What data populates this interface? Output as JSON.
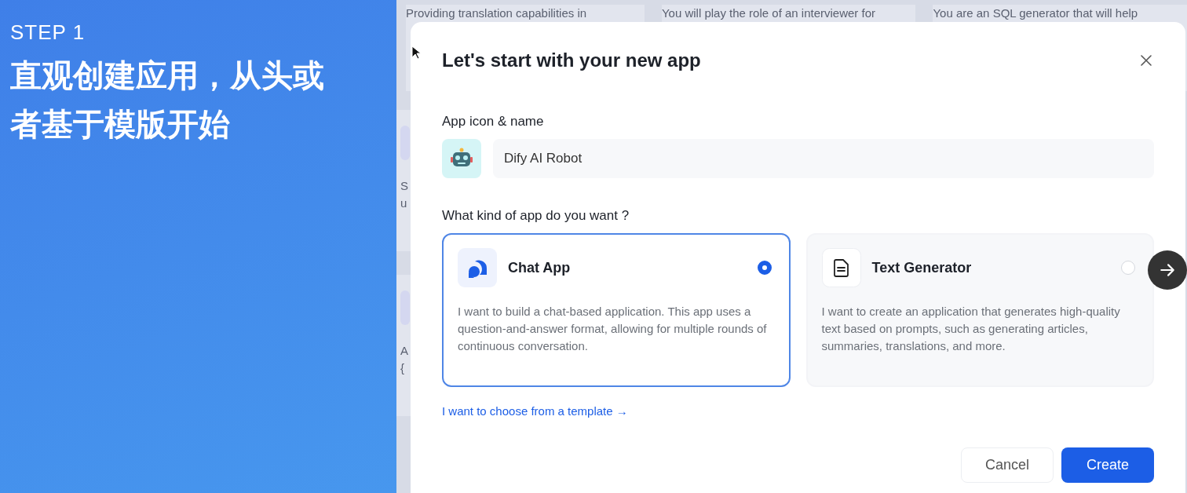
{
  "slide": {
    "step": "STEP 1",
    "headline": "直观创建应用，从头或者基于模版开始"
  },
  "background_cards": [
    {
      "lines": [
        "Providing translation capabilities in"
      ]
    },
    {
      "lines": [
        "You will play the role of an interviewer for"
      ]
    },
    {
      "lines": [
        "You are an SQL generator that will help"
      ]
    }
  ],
  "background_fragments": [
    {
      "lines": [
        "S",
        "u"
      ]
    },
    {
      "lines": [
        "A",
        "{"
      ]
    }
  ],
  "dialog": {
    "title": "Let's start with your new app",
    "icon_label": "App icon & name",
    "name_value": "Dify AI Robot",
    "question": "What kind of app do you want ?",
    "options": [
      {
        "kind": "chat",
        "title": "Chat App",
        "description": "I want to build a chat-based application. This app uses a question-and-answer format, allowing for multiple rounds of continuous conversation.",
        "selected": true
      },
      {
        "kind": "text",
        "title": "Text Generator",
        "description": "I want to create an application that generates high-quality text based on prompts, such as generating articles, summaries, translations, and more.",
        "selected": false
      }
    ],
    "template_link": "I want to choose from a template →",
    "buttons": [
      {
        "kind": "secondary",
        "label": "Cancel"
      },
      {
        "kind": "primary",
        "label": "Create"
      }
    ]
  }
}
